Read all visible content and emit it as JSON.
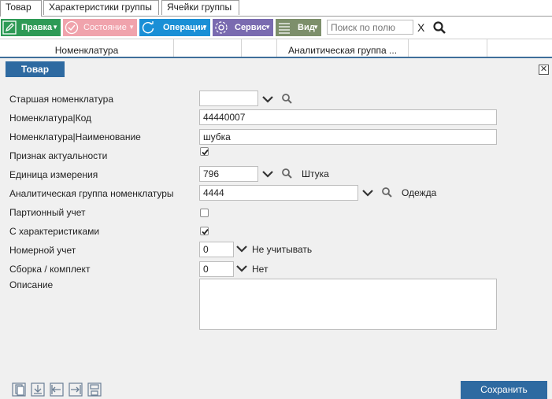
{
  "tabs": [
    {
      "label": "Товар"
    },
    {
      "label": "Характеристики группы"
    },
    {
      "label": "Ячейки группы"
    }
  ],
  "toolbar": {
    "edit_label": "Правка",
    "state_label": "Состояние",
    "operations_label": "Операции",
    "service_label": "Сервис",
    "view_label": "Вид",
    "search_placeholder": "Поиск по полю",
    "clear_label": "X"
  },
  "grid": {
    "columns": [
      "Номенклатура",
      "Аналитическая группа ..."
    ]
  },
  "dialog": {
    "title": "Товар",
    "close_label": "✕",
    "fields": {
      "parent_label": "Старшая номенклатура",
      "parent_value": "",
      "code_label": "Номенклатура|Код",
      "code_value": "44440007",
      "name_label": "Номенклатура|Наименование",
      "name_value": "шубка",
      "actual_label": "Признак актуальности",
      "actual_checked": true,
      "unit_label": "Единица измерения",
      "unit_value": "796",
      "unit_name": "Штука",
      "group_label": "Аналитическая группа номенклатуры",
      "group_value": "4444",
      "group_name": "Одежда",
      "batch_label": "Партионный учет",
      "batch_checked": false,
      "chars_label": "С характеристиками",
      "chars_checked": true,
      "serial_label": "Номерной учет",
      "serial_value": "0",
      "serial_name": "Не учитывать",
      "kit_label": "Сборка / комплект",
      "kit_value": "0",
      "kit_name": "Нет",
      "desc_label": "Описание",
      "desc_value": ""
    },
    "save_label": "Сохранить"
  },
  "colors": {
    "accent": "#2e6aa1",
    "edit": "#2e9a56",
    "state": "#f0a3ac",
    "operations": "#1a8fd6",
    "service": "#7a6bb0",
    "view": "#7d8f6b"
  }
}
